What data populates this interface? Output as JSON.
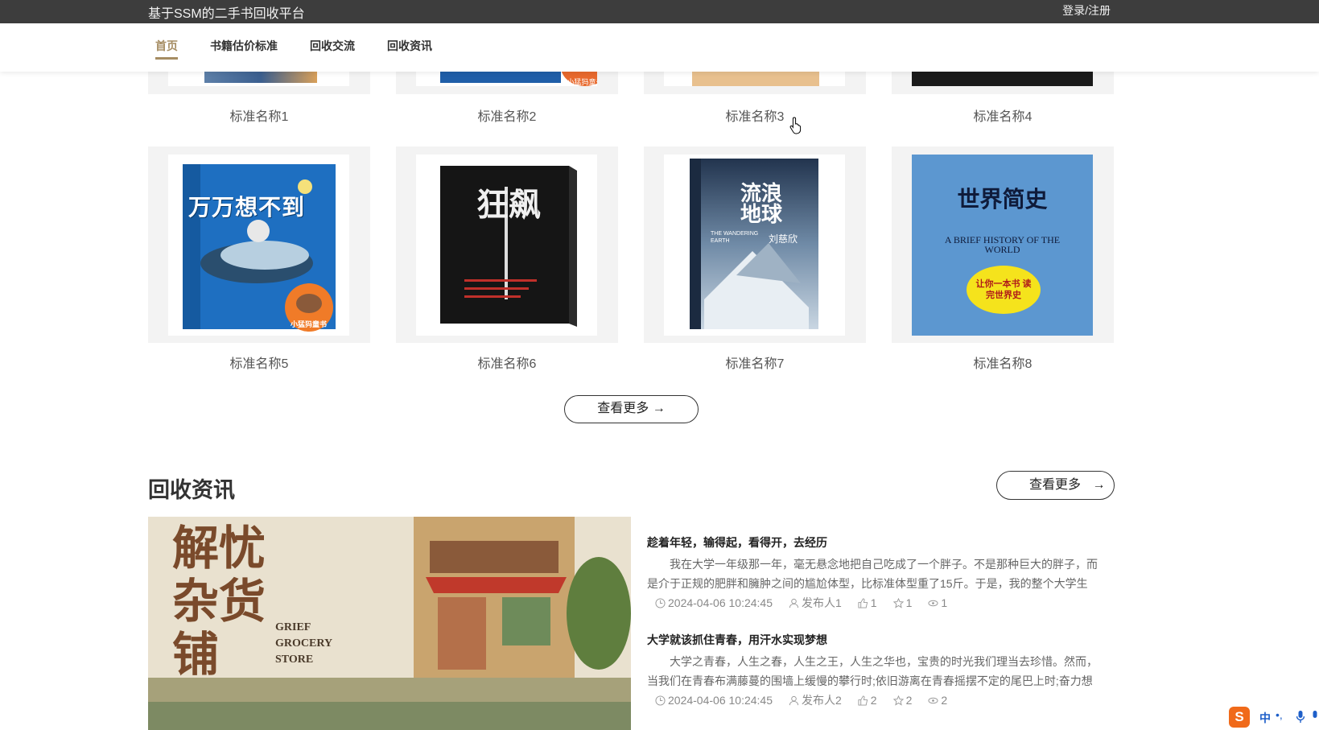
{
  "header": {
    "site_title": "基于SSM的二手书回收平台",
    "login_label": "登录/注册"
  },
  "nav": [
    {
      "label": "首页",
      "active": true
    },
    {
      "label": "书籍估价标准"
    },
    {
      "label": "回收交流"
    },
    {
      "label": "回收资讯"
    }
  ],
  "products_row1": [
    "标准名称1",
    "标准名称2",
    "标准名称3",
    "标准名称4"
  ],
  "products_row2": [
    "标准名称5",
    "标准名称6",
    "标准名称7",
    "标准名称8"
  ],
  "covers": {
    "c5_title": "万万想不到",
    "c5_badge": "小猛犸童书",
    "c2_badge": "小猛犸童书",
    "c6_title": "狂飙",
    "c7_title": "流浪地球",
    "c7_author": "刘慈欣",
    "c7_en": "THE WANDERING EARTH",
    "c8_title": "世界简史",
    "c8_en": "A BRIEF HISTORY OF THE WORLD",
    "c8_badge": "让你一本书 读完世界史"
  },
  "more_button": "查看更多 →",
  "news_section": {
    "title": "回收资讯",
    "more_label": "查看更多",
    "image_text": {
      "cn1": "解忧",
      "cn2": "杂货",
      "cn3": "铺",
      "en1": "GRIEF",
      "en2": "GROCERY",
      "en3": "STORE"
    },
    "items": [
      {
        "title": "趁着年轻，输得起，看得开，去经历",
        "body": "我在大学一年级那一年，毫无悬念地把自己吃成了一个胖子。不是那种巨大的胖子，而是介于正规的肥胖和臃肿之间的尴尬体型，比标准体型重了15斤。于是，我的整个大学生",
        "time": "2024-04-06 10:24:45",
        "author": "发布人1",
        "likes": "1",
        "favs": "1",
        "views": "1"
      },
      {
        "title": "大学就该抓住青春，用汗水实现梦想",
        "body": "大学之青春，人生之春，人生之王，人生之华也，宝贵的时光我们理当去珍惜。然而，当我们在青春布满藤蔓的围墙上缓慢的攀行时;依旧游离在青春摇摆不定的尾巴上时;奋力想",
        "time": "2024-04-06 10:24:45",
        "author": "发布人2",
        "likes": "2",
        "favs": "2",
        "views": "2"
      }
    ]
  },
  "ime": {
    "label": "中"
  }
}
